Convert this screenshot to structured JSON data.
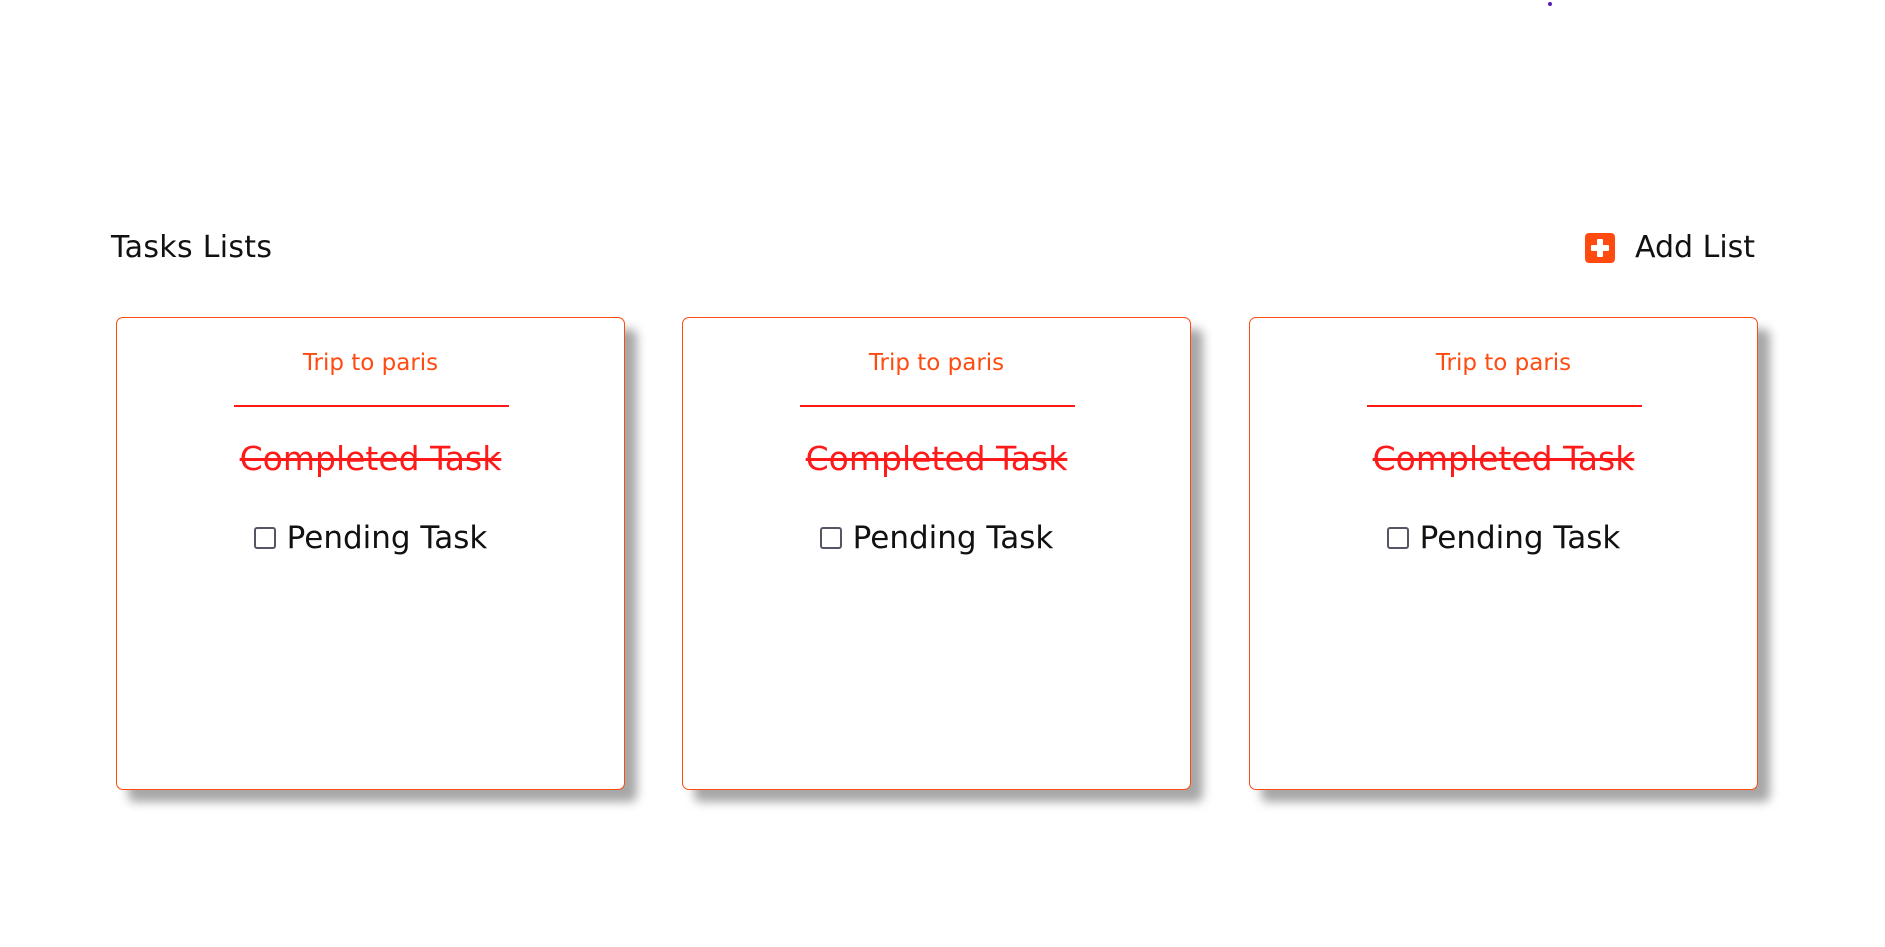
{
  "header": {
    "title": "Tasks Lists",
    "add_list_label": "Add List",
    "add_icon": "plus-square-icon"
  },
  "colors": {
    "accent": "#ff4a10",
    "completed": "#ff1a1a",
    "text": "#111111"
  },
  "lists": [
    {
      "title": "Trip to paris",
      "completed_task": "Completed Task",
      "pending_task": "Pending Task",
      "pending_checked": false
    },
    {
      "title": "Trip to paris",
      "completed_task": "Completed Task",
      "pending_task": "Pending Task",
      "pending_checked": false
    },
    {
      "title": "Trip to paris",
      "completed_task": "Completed Task",
      "pending_task": "Pending Task",
      "pending_checked": false
    }
  ]
}
